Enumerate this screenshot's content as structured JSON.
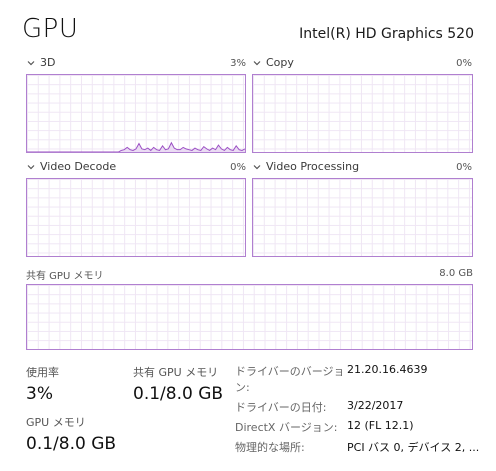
{
  "header": {
    "title": "GPU",
    "adapter_name": "Intel(R) HD Graphics 520"
  },
  "engines": [
    {
      "name": "3D",
      "percent": "3%",
      "usage_series": [
        0,
        0,
        0,
        0,
        0,
        0,
        0,
        0,
        0,
        0,
        0,
        0,
        0,
        0,
        0,
        0,
        0,
        0,
        0,
        0,
        0,
        0,
        0,
        0,
        0,
        0,
        0,
        0,
        0,
        0,
        0,
        0,
        2,
        3,
        6,
        3,
        2,
        4,
        11,
        4,
        3,
        5,
        2,
        6,
        3,
        2,
        8,
        3,
        4,
        12,
        5,
        3,
        3,
        6,
        4,
        3,
        2,
        5,
        3,
        2,
        7,
        4,
        2,
        5,
        3,
        9,
        4,
        2,
        6,
        3,
        2,
        8,
        3,
        2,
        4
      ]
    },
    {
      "name": "Copy",
      "percent": "0%"
    },
    {
      "name": "Video Decode",
      "percent": "0%"
    },
    {
      "name": "Video Processing",
      "percent": "0%"
    }
  ],
  "shared_memory_graph": {
    "label": "共有 GPU メモリ",
    "max": "8.0 GB"
  },
  "stats": {
    "utilization_label": "使用率",
    "utilization_value": "3%",
    "shared_label": "共有 GPU メモリ",
    "shared_value": "0.1/8.0 GB",
    "gpu_mem_label": "GPU メモリ",
    "gpu_mem_value": "0.1/8.0 GB"
  },
  "details": [
    {
      "key": "ドライバーのバージョン:",
      "value": "21.20.16.4639"
    },
    {
      "key": "ドライバーの日付:",
      "value": "3/22/2017"
    },
    {
      "key": "DirectX バージョン:",
      "value": "12 (FL 12.1)"
    },
    {
      "key": "物理的な場所:",
      "value": "PCI バス 0, デバイス 2, ..."
    }
  ],
  "colors": {
    "graph_border": "#b07fd0",
    "graph_line": "#9b4fc4",
    "graph_fill": "#eadbf3"
  }
}
